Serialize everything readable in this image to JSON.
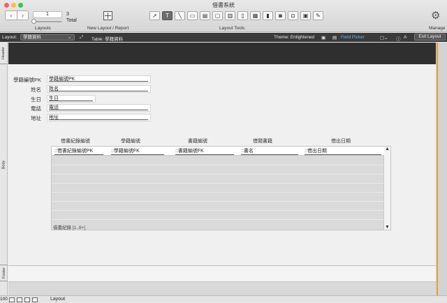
{
  "window": {
    "title": "借書系統"
  },
  "toolbar": {
    "record_value": "1",
    "count_value": "3",
    "count_label": "Total",
    "layouts_label": "Layouts",
    "new_layout_label": "New Layout / Report",
    "layout_tools_label": "Layout Tools",
    "manage_label": "Manage",
    "prev_icon": "‹",
    "next_icon": "›"
  },
  "layout_bar": {
    "layout_label": "Layout:",
    "layout_value": "學籍資料",
    "table_label": "Table: 學籍資料",
    "theme_label": "Theme: Enlightened",
    "field_picker_label": "Field Picker",
    "exit_layout_label": "Exit Layout"
  },
  "parts": {
    "header": "Header",
    "body": "Body",
    "footer": "Footer"
  },
  "fields": [
    {
      "label": "學籍編號PK",
      "value": "學籍編號PK"
    },
    {
      "label": "姓名",
      "value": "姓名"
    },
    {
      "label": "生日",
      "value": "生日"
    },
    {
      "label": "電話",
      "value": "電話"
    },
    {
      "label": "地址",
      "value": "地址"
    }
  ],
  "portal": {
    "headers": [
      "借書紀錄編號",
      "學籍編號",
      "書籍編號",
      "借閱書籍",
      "借出日期"
    ],
    "cells": [
      "::借書紀錄編號PK",
      "::學籍編號FK",
      "::書籍編號FK",
      "::書名",
      "::借出日期"
    ],
    "footer": "借書紀錄 [1..8+]"
  },
  "statusbar": {
    "zoom": "100",
    "mode": "Layout"
  },
  "colors": {
    "header_bg": "#2f2f2f",
    "accent": "#e0a233",
    "field_picker": "#6db3f2"
  }
}
